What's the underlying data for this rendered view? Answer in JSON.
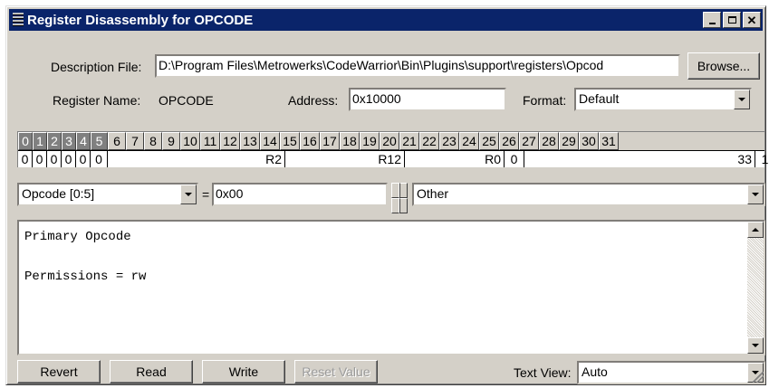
{
  "window": {
    "title": "Register Disassembly for OPCODE"
  },
  "description": {
    "label": "Description File:",
    "value": "D:\\Program Files\\Metrowerks\\CodeWarrior\\Bin\\Plugins\\support\\registers\\Opcod",
    "browse_label": "Browse..."
  },
  "register": {
    "name_label": "Register Name:",
    "name_value": "OPCODE",
    "address_label": "Address:",
    "address_value": "0x10000",
    "format_label": "Format:",
    "format_value": "Default"
  },
  "bits": {
    "labels": [
      "0",
      "1",
      "2",
      "3",
      "4",
      "5",
      "6",
      "7",
      "8",
      "9",
      "10",
      "11",
      "12",
      "13",
      "14",
      "15",
      "16",
      "17",
      "18",
      "19",
      "20",
      "21",
      "22",
      "23",
      "24",
      "25",
      "26",
      "27",
      "28",
      "29",
      "30",
      "31"
    ],
    "selected": [
      0,
      1,
      2,
      3,
      4,
      5
    ],
    "values": [
      {
        "text": "0"
      },
      {
        "text": "0"
      },
      {
        "text": "0"
      },
      {
        "text": "0"
      },
      {
        "text": "0"
      },
      {
        "text": "0"
      },
      {
        "text": "R2"
      },
      {
        "text": "R12"
      },
      {
        "text": "R0"
      },
      {
        "text": "0"
      },
      {
        "text": "33"
      },
      {
        "text": "1"
      }
    ]
  },
  "field": {
    "selector_value": "Opcode [0:5]",
    "equals": "=",
    "hex_value": "0x00",
    "meaning_value": "Other"
  },
  "description_text": "Primary Opcode\n\nPermissions = rw",
  "buttons": {
    "revert": "Revert",
    "read": "Read",
    "write": "Write",
    "reset": "Reset Value"
  },
  "text_view": {
    "label": "Text View:",
    "value": "Auto"
  }
}
